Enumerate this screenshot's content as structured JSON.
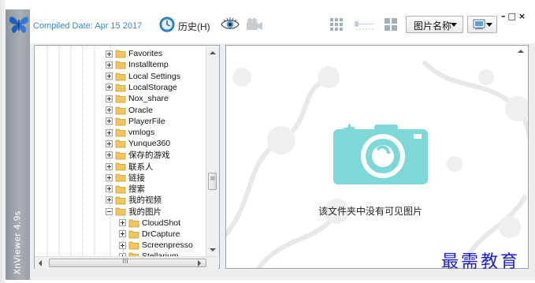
{
  "app": {
    "vertical_title": "XnViewer 4.9s",
    "compiled_date": "Compiled Date: Apr 15 2017",
    "window_controls": "–□×",
    "accent_color": "#3b86c4"
  },
  "toolbar": {
    "history_label": "历史(H)",
    "sort_label": "图片名称",
    "icons": [
      "history-icon",
      "eye-icon",
      "camera-icon",
      "grid-icon",
      "slider-icon",
      "grid-compact-icon",
      "view-mode-icon"
    ]
  },
  "tree": {
    "items": [
      {
        "label": "Favorites",
        "expanded": false
      },
      {
        "label": "Installtemp",
        "expanded": false
      },
      {
        "label": "Local Settings",
        "expanded": false
      },
      {
        "label": "LocalStorage",
        "expanded": false
      },
      {
        "label": "Nox_share",
        "expanded": false
      },
      {
        "label": "Oracle",
        "expanded": false
      },
      {
        "label": "PlayerFile",
        "expanded": false
      },
      {
        "label": "vmlogs",
        "expanded": false
      },
      {
        "label": "Yunque360",
        "expanded": false
      },
      {
        "label": "保存的游戏",
        "expanded": false
      },
      {
        "label": "联系人",
        "expanded": false
      },
      {
        "label": "链接",
        "expanded": false
      },
      {
        "label": "搜索",
        "expanded": false
      },
      {
        "label": "我的视频",
        "expanded": false
      },
      {
        "label": "我的图片",
        "expanded": true
      },
      {
        "label": "CloudShot",
        "expanded": false
      },
      {
        "label": "DrCapture",
        "expanded": false
      },
      {
        "label": "Screenpresso",
        "expanded": false
      },
      {
        "label": "Stellarium",
        "expanded": false
      }
    ],
    "hscroll_grip": "III"
  },
  "preview": {
    "empty_message": "该文件夹中没有可见图片"
  },
  "watermark": "最需教育"
}
